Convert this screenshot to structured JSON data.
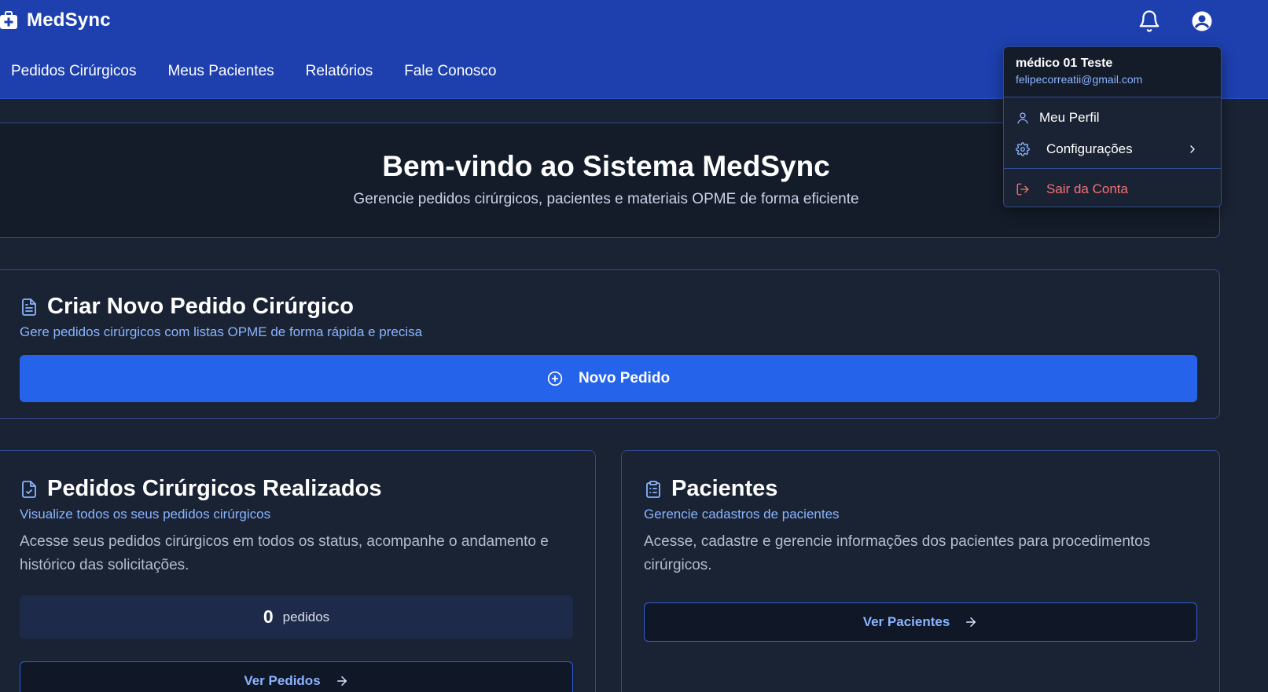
{
  "app": {
    "name": "MedSync"
  },
  "nav": {
    "items": [
      {
        "label": "Pedidos Cirúrgicos"
      },
      {
        "label": "Meus Pacientes"
      },
      {
        "label": "Relatórios"
      },
      {
        "label": "Fale Conosco"
      }
    ]
  },
  "header": {
    "bell_icon": "bell-icon",
    "user_icon": "user-circle-icon"
  },
  "user_menu": {
    "name": "médico 01 Teste",
    "email": "felipecorreatii@gmail.com",
    "profile_label": "Meu Perfil",
    "settings_label": "Configurações",
    "logout_label": "Sair da Conta"
  },
  "welcome": {
    "title": "Bem-vindo ao Sistema MedSync",
    "subtitle": "Gerencie pedidos cirúrgicos, pacientes e materiais OPME de forma eficiente"
  },
  "create_order": {
    "title": "Criar Novo Pedido Cirúrgico",
    "subtitle": "Gere pedidos cirúrgicos com listas OPME de forma rápida e precisa",
    "button_label": "Novo Pedido"
  },
  "orders": {
    "title": "Pedidos Cirúrgicos Realizados",
    "subtitle": "Visualize todos os seus pedidos cirúrgicos",
    "description": "Acesse seus pedidos cirúrgicos em todos os status, acompanhe o andamento e histórico das solicitações.",
    "count": "0",
    "count_unit": "pedidos",
    "button_label": "Ver Pedidos"
  },
  "patients": {
    "title": "Pacientes",
    "subtitle": "Gerencie cadastros de pacientes",
    "description": "Acesse, cadastre e gerencie informações dos pacientes para procedimentos cirúrgicos.",
    "button_label": "Ver Pacientes"
  },
  "colors": {
    "header_bg": "#1e40af",
    "page_bg": "#1a2333",
    "primary": "#2563eb",
    "accent_text": "#8ab4ff",
    "danger": "#f87171"
  }
}
